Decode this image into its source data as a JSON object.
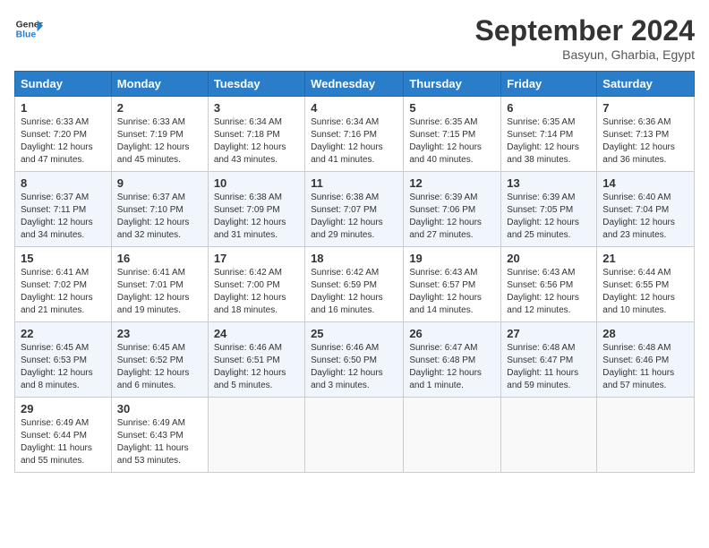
{
  "header": {
    "logo_line1": "General",
    "logo_line2": "Blue",
    "month": "September 2024",
    "location": "Basyun, Gharbia, Egypt"
  },
  "weekdays": [
    "Sunday",
    "Monday",
    "Tuesday",
    "Wednesday",
    "Thursday",
    "Friday",
    "Saturday"
  ],
  "weeks": [
    [
      {
        "day": "1",
        "info": "Sunrise: 6:33 AM\nSunset: 7:20 PM\nDaylight: 12 hours\nand 47 minutes."
      },
      {
        "day": "2",
        "info": "Sunrise: 6:33 AM\nSunset: 7:19 PM\nDaylight: 12 hours\nand 45 minutes."
      },
      {
        "day": "3",
        "info": "Sunrise: 6:34 AM\nSunset: 7:18 PM\nDaylight: 12 hours\nand 43 minutes."
      },
      {
        "day": "4",
        "info": "Sunrise: 6:34 AM\nSunset: 7:16 PM\nDaylight: 12 hours\nand 41 minutes."
      },
      {
        "day": "5",
        "info": "Sunrise: 6:35 AM\nSunset: 7:15 PM\nDaylight: 12 hours\nand 40 minutes."
      },
      {
        "day": "6",
        "info": "Sunrise: 6:35 AM\nSunset: 7:14 PM\nDaylight: 12 hours\nand 38 minutes."
      },
      {
        "day": "7",
        "info": "Sunrise: 6:36 AM\nSunset: 7:13 PM\nDaylight: 12 hours\nand 36 minutes."
      }
    ],
    [
      {
        "day": "8",
        "info": "Sunrise: 6:37 AM\nSunset: 7:11 PM\nDaylight: 12 hours\nand 34 minutes."
      },
      {
        "day": "9",
        "info": "Sunrise: 6:37 AM\nSunset: 7:10 PM\nDaylight: 12 hours\nand 32 minutes."
      },
      {
        "day": "10",
        "info": "Sunrise: 6:38 AM\nSunset: 7:09 PM\nDaylight: 12 hours\nand 31 minutes."
      },
      {
        "day": "11",
        "info": "Sunrise: 6:38 AM\nSunset: 7:07 PM\nDaylight: 12 hours\nand 29 minutes."
      },
      {
        "day": "12",
        "info": "Sunrise: 6:39 AM\nSunset: 7:06 PM\nDaylight: 12 hours\nand 27 minutes."
      },
      {
        "day": "13",
        "info": "Sunrise: 6:39 AM\nSunset: 7:05 PM\nDaylight: 12 hours\nand 25 minutes."
      },
      {
        "day": "14",
        "info": "Sunrise: 6:40 AM\nSunset: 7:04 PM\nDaylight: 12 hours\nand 23 minutes."
      }
    ],
    [
      {
        "day": "15",
        "info": "Sunrise: 6:41 AM\nSunset: 7:02 PM\nDaylight: 12 hours\nand 21 minutes."
      },
      {
        "day": "16",
        "info": "Sunrise: 6:41 AM\nSunset: 7:01 PM\nDaylight: 12 hours\nand 19 minutes."
      },
      {
        "day": "17",
        "info": "Sunrise: 6:42 AM\nSunset: 7:00 PM\nDaylight: 12 hours\nand 18 minutes."
      },
      {
        "day": "18",
        "info": "Sunrise: 6:42 AM\nSunset: 6:59 PM\nDaylight: 12 hours\nand 16 minutes."
      },
      {
        "day": "19",
        "info": "Sunrise: 6:43 AM\nSunset: 6:57 PM\nDaylight: 12 hours\nand 14 minutes."
      },
      {
        "day": "20",
        "info": "Sunrise: 6:43 AM\nSunset: 6:56 PM\nDaylight: 12 hours\nand 12 minutes."
      },
      {
        "day": "21",
        "info": "Sunrise: 6:44 AM\nSunset: 6:55 PM\nDaylight: 12 hours\nand 10 minutes."
      }
    ],
    [
      {
        "day": "22",
        "info": "Sunrise: 6:45 AM\nSunset: 6:53 PM\nDaylight: 12 hours\nand 8 minutes."
      },
      {
        "day": "23",
        "info": "Sunrise: 6:45 AM\nSunset: 6:52 PM\nDaylight: 12 hours\nand 6 minutes."
      },
      {
        "day": "24",
        "info": "Sunrise: 6:46 AM\nSunset: 6:51 PM\nDaylight: 12 hours\nand 5 minutes."
      },
      {
        "day": "25",
        "info": "Sunrise: 6:46 AM\nSunset: 6:50 PM\nDaylight: 12 hours\nand 3 minutes."
      },
      {
        "day": "26",
        "info": "Sunrise: 6:47 AM\nSunset: 6:48 PM\nDaylight: 12 hours\nand 1 minute."
      },
      {
        "day": "27",
        "info": "Sunrise: 6:48 AM\nSunset: 6:47 PM\nDaylight: 11 hours\nand 59 minutes."
      },
      {
        "day": "28",
        "info": "Sunrise: 6:48 AM\nSunset: 6:46 PM\nDaylight: 11 hours\nand 57 minutes."
      }
    ],
    [
      {
        "day": "29",
        "info": "Sunrise: 6:49 AM\nSunset: 6:44 PM\nDaylight: 11 hours\nand 55 minutes."
      },
      {
        "day": "30",
        "info": "Sunrise: 6:49 AM\nSunset: 6:43 PM\nDaylight: 11 hours\nand 53 minutes."
      },
      null,
      null,
      null,
      null,
      null
    ]
  ]
}
